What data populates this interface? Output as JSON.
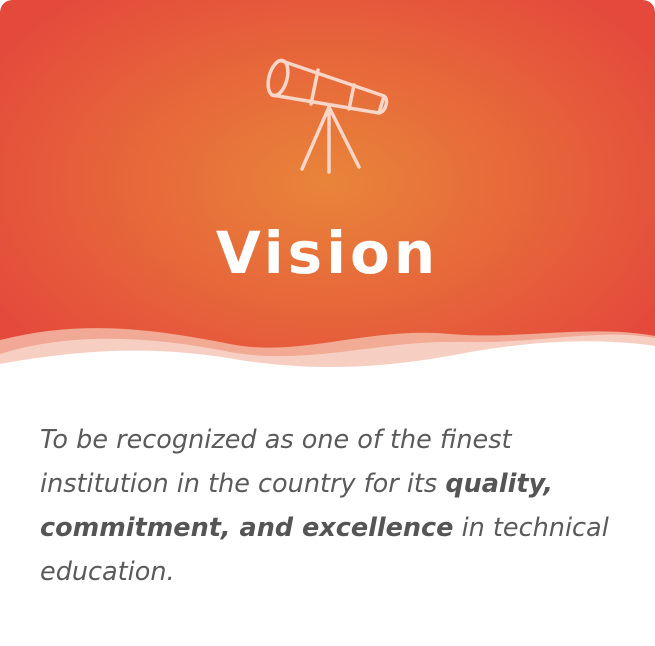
{
  "card": {
    "icon": "telescope-icon",
    "title": "Vision",
    "statement": {
      "lead": "To be recognized as one of the finest institution in the country for its ",
      "emphasis": "quality, commitment, and excellence",
      "tail": " in technical education."
    }
  },
  "colors": {
    "gradient_center": "#e8843a",
    "gradient_edge": "#e4493c",
    "title": "#ffffff",
    "body_text": "#5a5a5a"
  }
}
